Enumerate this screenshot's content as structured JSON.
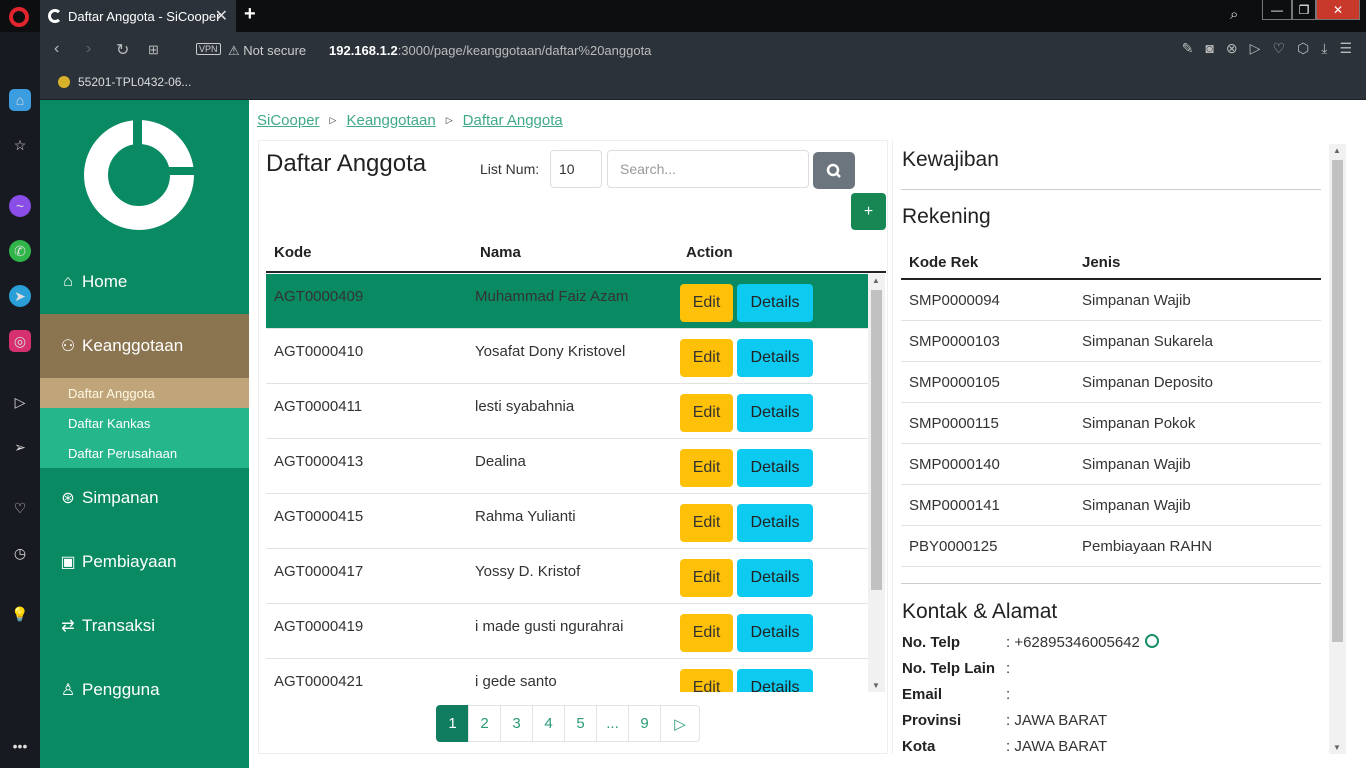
{
  "browser": {
    "tab_title": "Daftar Anggota - SiCooper",
    "tab_close": "✕",
    "new_tab": "+",
    "vpn_label": "VPN",
    "security_label": "Not secure",
    "url_host": "192.168.1.2",
    "url_path": ":3000/page/keanggotaan/daftar%20anggota",
    "bookmark_label": "55201-TPL0432-06...",
    "minimize": "—",
    "maximize": "❐",
    "close": "✕"
  },
  "sidebar": {
    "menu": [
      {
        "label": "Home",
        "icon": "home-icon"
      },
      {
        "label": "Keanggotaan",
        "icon": "users-icon"
      },
      {
        "label": "Simpanan",
        "icon": "lifebuoy-icon"
      },
      {
        "label": "Pembiayaan",
        "icon": "cash-icon"
      },
      {
        "label": "Transaksi",
        "icon": "transfer-icon"
      },
      {
        "label": "Pengguna",
        "icon": "user-check-icon"
      }
    ],
    "submenu": [
      {
        "label": "Daftar Anggota",
        "active": true
      },
      {
        "label": "Daftar Kankas",
        "active": false
      },
      {
        "label": "Daftar Perusahaan",
        "active": false
      }
    ]
  },
  "breadcrumb": [
    "SiCooper",
    "Keanggotaan",
    "Daftar Anggota"
  ],
  "main": {
    "title": "Daftar Anggota",
    "list_num_label": "List Num:",
    "list_num_value": "10",
    "search_placeholder": "Search...",
    "add_label": "+",
    "columns": [
      "Kode",
      "Nama",
      "Action"
    ],
    "edit_label": "Edit",
    "details_label": "Details",
    "rows": [
      {
        "kode": "AGT0000409",
        "nama": "Muhammad Faiz Azam"
      },
      {
        "kode": "AGT0000410",
        "nama": "Yosafat Dony Kristovel"
      },
      {
        "kode": "AGT0000411",
        "nama": "lesti syabahnia"
      },
      {
        "kode": "AGT0000413",
        "nama": "Dealina"
      },
      {
        "kode": "AGT0000415",
        "nama": "Rahma Yulianti"
      },
      {
        "kode": "AGT0000417",
        "nama": "Yossy D. Kristof"
      },
      {
        "kode": "AGT0000419",
        "nama": "i made gusti ngurahrai"
      },
      {
        "kode": "AGT0000421",
        "nama": "i gede santo"
      }
    ],
    "pagination": [
      "1",
      "2",
      "3",
      "4",
      "5",
      "...",
      "9",
      "▷"
    ],
    "current_page": "1"
  },
  "detail": {
    "kewajiban_title": "Kewajiban",
    "rekening_title": "Rekening",
    "rekening_columns": [
      "Kode Rek",
      "Jenis"
    ],
    "rekening_rows": [
      {
        "kode": "SMP0000094",
        "jenis": "Simpanan Wajib"
      },
      {
        "kode": "SMP0000103",
        "jenis": "Simpanan Sukarela"
      },
      {
        "kode": "SMP0000105",
        "jenis": "Simpanan Deposito"
      },
      {
        "kode": "SMP0000115",
        "jenis": "Simpanan Pokok"
      },
      {
        "kode": "SMP0000140",
        "jenis": "Simpanan Wajib"
      },
      {
        "kode": "SMP0000141",
        "jenis": "Simpanan Wajib"
      },
      {
        "kode": "PBY0000125",
        "jenis": "Pembiayaan RAHN"
      }
    ],
    "kontak_title": "Kontak & Alamat",
    "kontak": [
      {
        "label": "No. Telp",
        "value": ": +62895346005642",
        "whatsapp": true
      },
      {
        "label": "No. Telp Lain",
        "value": ":"
      },
      {
        "label": "Email",
        "value": ":"
      },
      {
        "label": "Provinsi",
        "value": ": JAWA BARAT"
      },
      {
        "label": "Kota",
        "value": ": JAWA BARAT"
      }
    ]
  },
  "colors": {
    "primary_green": "#0a8a62",
    "active_menu": "#8b7450",
    "active_submenu": "#c0a57a",
    "submenu_bg": "#26b68b",
    "edit_btn": "#ffc107",
    "details_btn": "#0dcaf0",
    "search_btn": "#6c757d",
    "add_btn": "#198754"
  }
}
